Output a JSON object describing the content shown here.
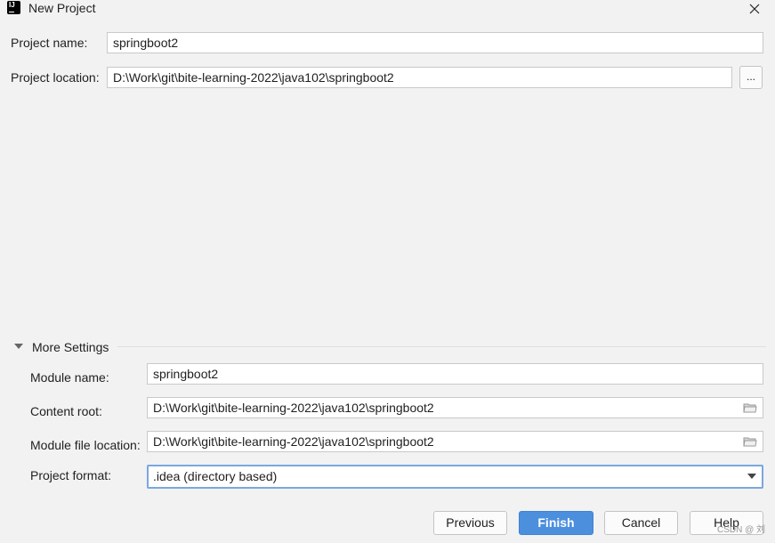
{
  "window": {
    "title": "New Project"
  },
  "fields": {
    "project_name": {
      "label": "Project name:",
      "value": "springboot2"
    },
    "project_location": {
      "label": "Project location:",
      "value": "D:\\Work\\git\\bite-learning-2022\\java102\\springboot2",
      "browse_label": "..."
    }
  },
  "more_settings": {
    "label": "More Settings",
    "module_name": {
      "label": "Module name:",
      "value": "springboot2"
    },
    "content_root": {
      "label": "Content root:",
      "value": "D:\\Work\\git\\bite-learning-2022\\java102\\springboot2"
    },
    "module_file_location": {
      "label": "Module file location:",
      "value": "D:\\Work\\git\\bite-learning-2022\\java102\\springboot2"
    },
    "project_format": {
      "label": "Project format:",
      "value": ".idea (directory based)"
    }
  },
  "buttons": {
    "previous": "Previous",
    "finish": "Finish",
    "cancel": "Cancel",
    "help": "Help"
  },
  "watermark": "CSDN @ 刘",
  "icons": {
    "app": "intellij-idea-icon",
    "close": "close-icon",
    "collapse": "triangle-down-icon",
    "folder": "folder-icon",
    "dropdown": "chevron-down-icon"
  },
  "colors": {
    "accent": "#4C8FDD",
    "focus_border": "#7AA7E0",
    "background": "#F2F2F2"
  }
}
